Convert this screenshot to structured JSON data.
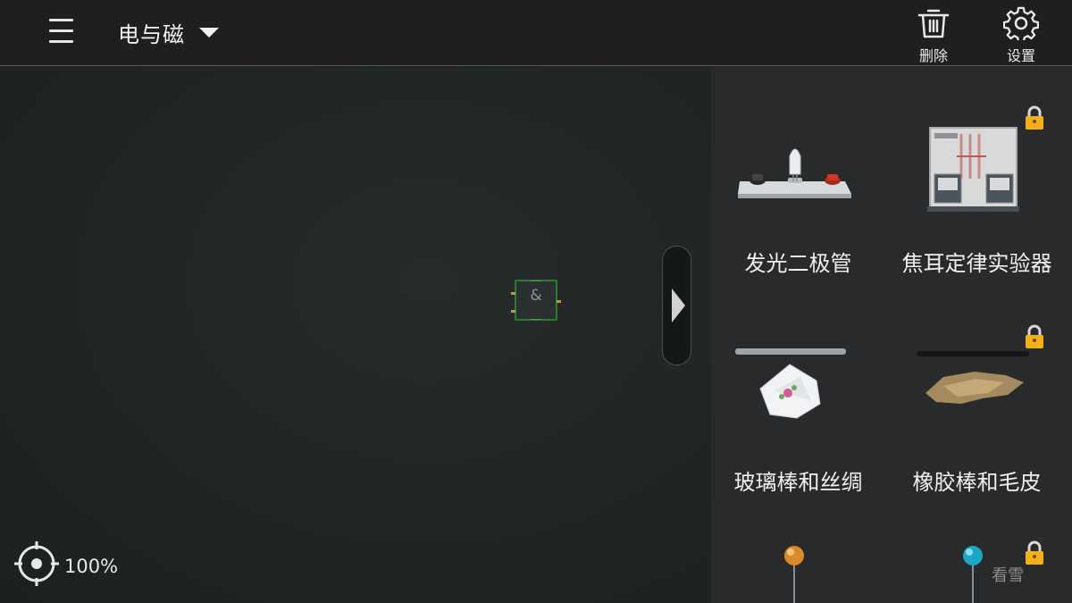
{
  "header": {
    "category": "电与磁",
    "actions": [
      {
        "label": "删除",
        "icon": "trash-icon"
      },
      {
        "label": "设置",
        "icon": "gear-icon"
      }
    ]
  },
  "canvas": {
    "gate_symbol": "&",
    "zoom": "100%"
  },
  "panel": {
    "items": [
      {
        "label": "发光二极管",
        "locked": false
      },
      {
        "label": "焦耳定律实验器",
        "locked": true
      },
      {
        "label": "玻璃棒和丝绸",
        "locked": false
      },
      {
        "label": "橡胶棒和毛皮",
        "locked": true
      },
      {
        "label": "",
        "locked": false
      },
      {
        "label": "",
        "locked": true
      }
    ]
  },
  "watermark": "看雪",
  "colors": {
    "topbar": "#1f1f1f",
    "canvas": "#1f2423",
    "panel": "#292a2c",
    "gate_border": "#2e7a32",
    "lock": "#f2b01a"
  }
}
